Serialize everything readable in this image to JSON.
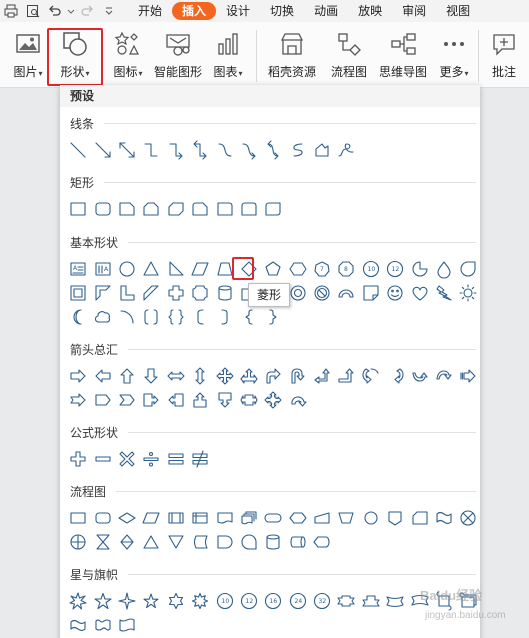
{
  "menu": {
    "tabs": [
      {
        "label": "开始",
        "active": false
      },
      {
        "label": "插入",
        "active": true
      },
      {
        "label": "设计",
        "active": false
      },
      {
        "label": "切换",
        "active": false
      },
      {
        "label": "动画",
        "active": false
      },
      {
        "label": "放映",
        "active": false
      },
      {
        "label": "审阅",
        "active": false
      },
      {
        "label": "视图",
        "active": false
      }
    ],
    "quick_icons": [
      "print-icon",
      "print-preview-icon",
      "undo-icon",
      "redo-icon",
      "customize-dropdown-icon"
    ]
  },
  "ribbon": {
    "picture": "图片",
    "shape": "形状",
    "icon": "图标",
    "smart_graphic": "智能图形",
    "chart": "图表",
    "resource": "稻壳资源",
    "flowchart": "流程图",
    "mindmap": "思维导图",
    "more": "更多",
    "comment": "批注"
  },
  "panel": {
    "header": "预设",
    "sections": {
      "lines": "线条",
      "rectangles": "矩形",
      "basic": "基本形状",
      "arrows": "箭头总汇",
      "formula": "公式形状",
      "flow": "流程图",
      "stars": "星与旗帜"
    },
    "basic_numbers": [
      "7",
      "8",
      "10",
      "12"
    ],
    "star_numbers": [
      "10",
      "12",
      "16",
      "24",
      "32"
    ]
  },
  "tooltip": "菱形",
  "watermark": {
    "line1": "Baidu经验",
    "line2": "jingyan.baidu.com"
  },
  "colors": {
    "accent": "#f2661f",
    "highlight": "#e0262a",
    "shape_stroke": "#2f5f8d"
  }
}
